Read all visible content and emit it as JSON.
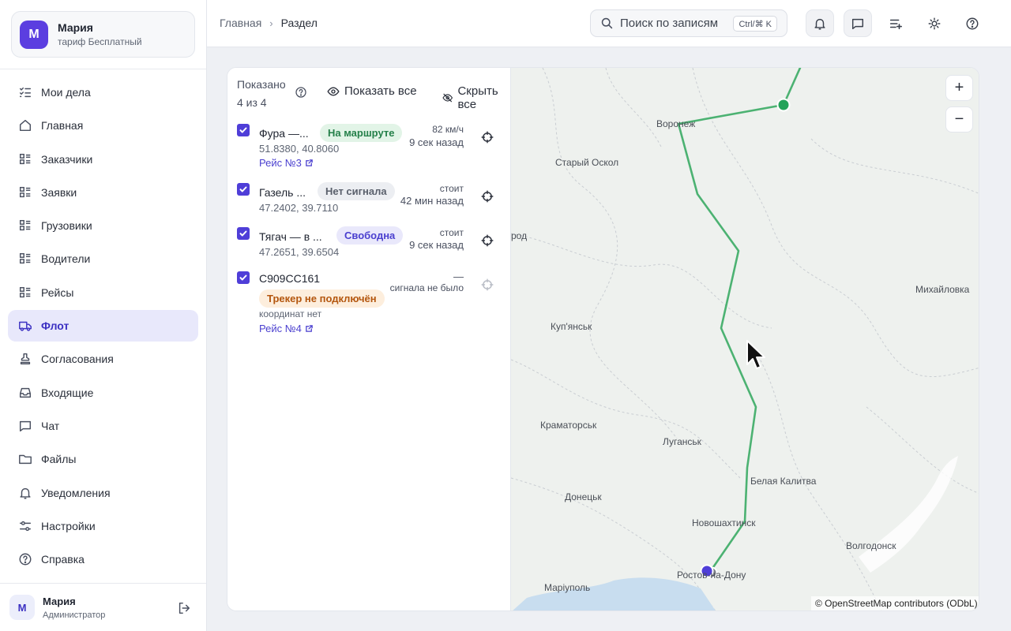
{
  "account": {
    "avatar_letter": "М",
    "name": "Мария",
    "plan": "тариф Бесплатный"
  },
  "nav": [
    {
      "label": "Мои дела",
      "icon": "list-check-icon"
    },
    {
      "label": "Главная",
      "icon": "home-icon"
    },
    {
      "label": "Заказчики",
      "icon": "list-icon"
    },
    {
      "label": "Заявки",
      "icon": "list-icon"
    },
    {
      "label": "Грузовики",
      "icon": "list-icon"
    },
    {
      "label": "Водители",
      "icon": "list-icon"
    },
    {
      "label": "Рейсы",
      "icon": "list-icon"
    },
    {
      "label": "Флот",
      "icon": "truck-icon",
      "active": true
    },
    {
      "label": "Согласования",
      "icon": "stamp-icon"
    },
    {
      "label": "Входящие",
      "icon": "inbox-icon"
    },
    {
      "label": "Чат",
      "icon": "chat-icon"
    },
    {
      "label": "Файлы",
      "icon": "folder-icon"
    },
    {
      "label": "Уведомления",
      "icon": "bell-icon"
    },
    {
      "label": "Настройки",
      "icon": "sliders-icon"
    },
    {
      "label": "Справка",
      "icon": "help-icon"
    }
  ],
  "user": {
    "avatar_letter": "М",
    "name": "Мария",
    "role": "Администратор"
  },
  "breadcrumbs": {
    "home": "Главная",
    "section": "Раздел"
  },
  "search": {
    "placeholder": "Поиск по записям",
    "shortcut": "Ctrl/⌘ K"
  },
  "panel": {
    "shown_label": "Показано",
    "shown_count": "4 из 4",
    "show_all": "Показать все",
    "hide_all": "Скрыть все"
  },
  "vehicles": [
    {
      "name": "Фура —...",
      "status": "На маршруте",
      "status_color": "#25804a",
      "coords": "51.8380, 40.8060",
      "trip": "Рейс №3",
      "right1": "82 км/ч",
      "right2": "9 сек назад",
      "checked": true
    },
    {
      "name": "Газель ...",
      "status": "Нет сигнала",
      "status_color": "#5a606c",
      "coords": "47.2402, 39.7110",
      "trip": "",
      "right1": "стоит",
      "right2": "42 мин назад",
      "checked": true
    },
    {
      "name": "Тягач — в ...",
      "status": "Свободна",
      "status_color": "#4a3fcf",
      "coords": "47.2651, 39.6504",
      "trip": "",
      "right1": "стоит",
      "right2": "9 сек назад",
      "checked": true
    },
    {
      "name": "С909СС161",
      "status": "Трекер не подключён",
      "status_color": "#b4560e",
      "coords": "координат нет",
      "trip": "Рейс №4",
      "right1": "—",
      "right2": "сигнала не было",
      "checked": true
    }
  ],
  "map": {
    "cities": [
      "Воронеж",
      "Старый Оскол",
      "род",
      "Михайловка",
      "Куп'янськ",
      "Краматорськ",
      "Луганськ",
      "Белая Калитва",
      "Донецьк",
      "Новошахтинск",
      "Волгодонск",
      "Ростов-на-Дону",
      "Маріуполь"
    ],
    "zoom_in": "+",
    "zoom_out": "−",
    "attribution": "© OpenStreetMap contributors (ODbL)",
    "route_color": "#4cb272",
    "marker_colors": {
      "start": "#4f3ed8",
      "end": "#25a35a"
    }
  }
}
